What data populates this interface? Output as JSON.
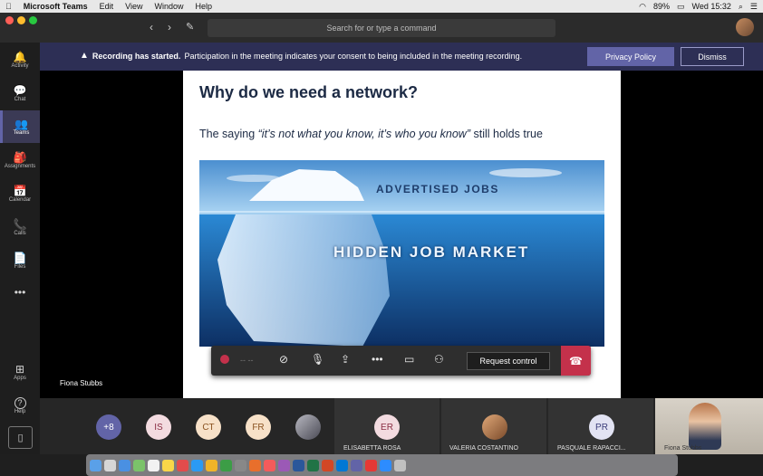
{
  "menubar": {
    "app": "Microsoft Teams",
    "menus": [
      "Edit",
      "View",
      "Window",
      "Help"
    ],
    "battery": "89%",
    "clock": "Wed 15:32"
  },
  "search": {
    "placeholder": "Search for or type a command"
  },
  "rail": [
    {
      "label": "Activity",
      "glyph": "🔔"
    },
    {
      "label": "Chat",
      "glyph": "💬"
    },
    {
      "label": "Teams",
      "glyph": "👥"
    },
    {
      "label": "Assignments",
      "glyph": "🎒"
    },
    {
      "label": "Calendar",
      "glyph": "📅"
    },
    {
      "label": "Calls",
      "glyph": "📞"
    },
    {
      "label": "Files",
      "glyph": "📄"
    },
    {
      "label": "",
      "glyph": "•••"
    },
    {
      "label": "Apps",
      "glyph": "⊞"
    },
    {
      "label": "Help",
      "glyph": "?"
    }
  ],
  "banner": {
    "bold": "Recording has started.",
    "text": "Participation in the meeting indicates your consent to being included in the meeting recording.",
    "privacy_label": "Privacy Policy",
    "dismiss_label": "Dismiss"
  },
  "slide": {
    "title": "Why do we need a network?",
    "sub_pre": "The saying ",
    "sub_quote": "“it’s not what you know, it’s who you know”",
    "sub_post": " still holds true",
    "img_top_text": "ADVERTISED JOBS",
    "img_bottom_text": "HIDDEN JOB MARKET"
  },
  "presenter": "Fiona Stubbs",
  "controls": {
    "request_label": "Request control"
  },
  "participants": {
    "bubbles": [
      {
        "initials": "+8"
      },
      {
        "initials": "IS"
      },
      {
        "initials": "CT"
      },
      {
        "initials": "FR"
      }
    ],
    "tiles": [
      {
        "initials": "ER",
        "name": "ELISABETTA ROSA"
      },
      {
        "initials": "",
        "name": "VALERIA COSTANTINO"
      },
      {
        "initials": "PR",
        "name": "PASQUALE RAPACCI..."
      },
      {
        "initials": "",
        "name": "Fiona Stubbs"
      }
    ]
  },
  "colors": {
    "accent": "#6264a7",
    "banner": "#2d2f55",
    "hangup": "#c4314b"
  }
}
